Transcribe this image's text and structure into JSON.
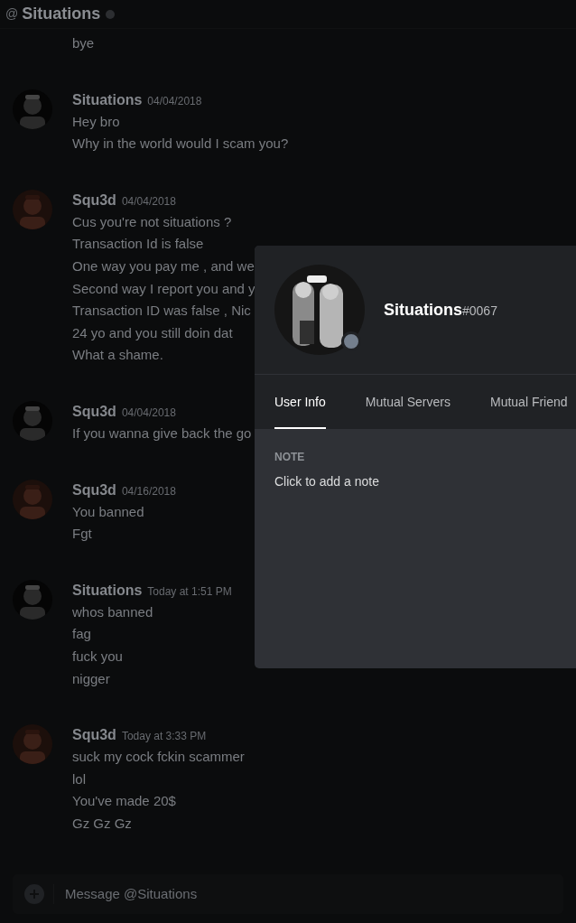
{
  "header": {
    "prefix": "@",
    "title": "Situations"
  },
  "messages": [
    {
      "lines": [
        "bye"
      ]
    },
    {
      "author": "Situations",
      "timestamp": "04/04/2018",
      "lines": [
        "Hey bro",
        "Why in the world would I scam you?"
      ]
    },
    {
      "author": "Squ3d",
      "timestamp": "04/04/2018",
      "lines": [
        "Cus you're not situations ?",
        "Transaction Id is false",
        "One way you pay me , and we",
        "Second way I report you and y",
        "Transaction ID was false , Nic",
        "24 yo and you still doin dat",
        "What a shame."
      ]
    },
    {
      "author": "Squ3d",
      "timestamp": "04/04/2018",
      "lines": [
        "If you wanna give back the go"
      ]
    },
    {
      "author": "Squ3d",
      "timestamp": "04/16/2018",
      "lines": [
        "You banned",
        "Fgt"
      ]
    },
    {
      "author": "Situations",
      "timestamp": "Today at 1:51 PM",
      "lines": [
        "whos banned",
        "fag",
        "fuck you",
        "nigger"
      ]
    },
    {
      "author": "Squ3d",
      "timestamp": "Today at 3:33 PM",
      "lines": [
        "suck my cock fckin scammer",
        "lol",
        "You've made 20$",
        "Gz Gz Gz"
      ]
    }
  ],
  "composer": {
    "placeholder": "Message @Situations"
  },
  "profile": {
    "username": "Situations",
    "discriminator": "#0067",
    "tabs": [
      {
        "label": "User Info",
        "selected": true
      },
      {
        "label": "Mutual Servers",
        "selected": false
      },
      {
        "label": "Mutual Friend",
        "selected": false
      }
    ],
    "note_label": "NOTE",
    "note_placeholder": "Click to add a note"
  }
}
